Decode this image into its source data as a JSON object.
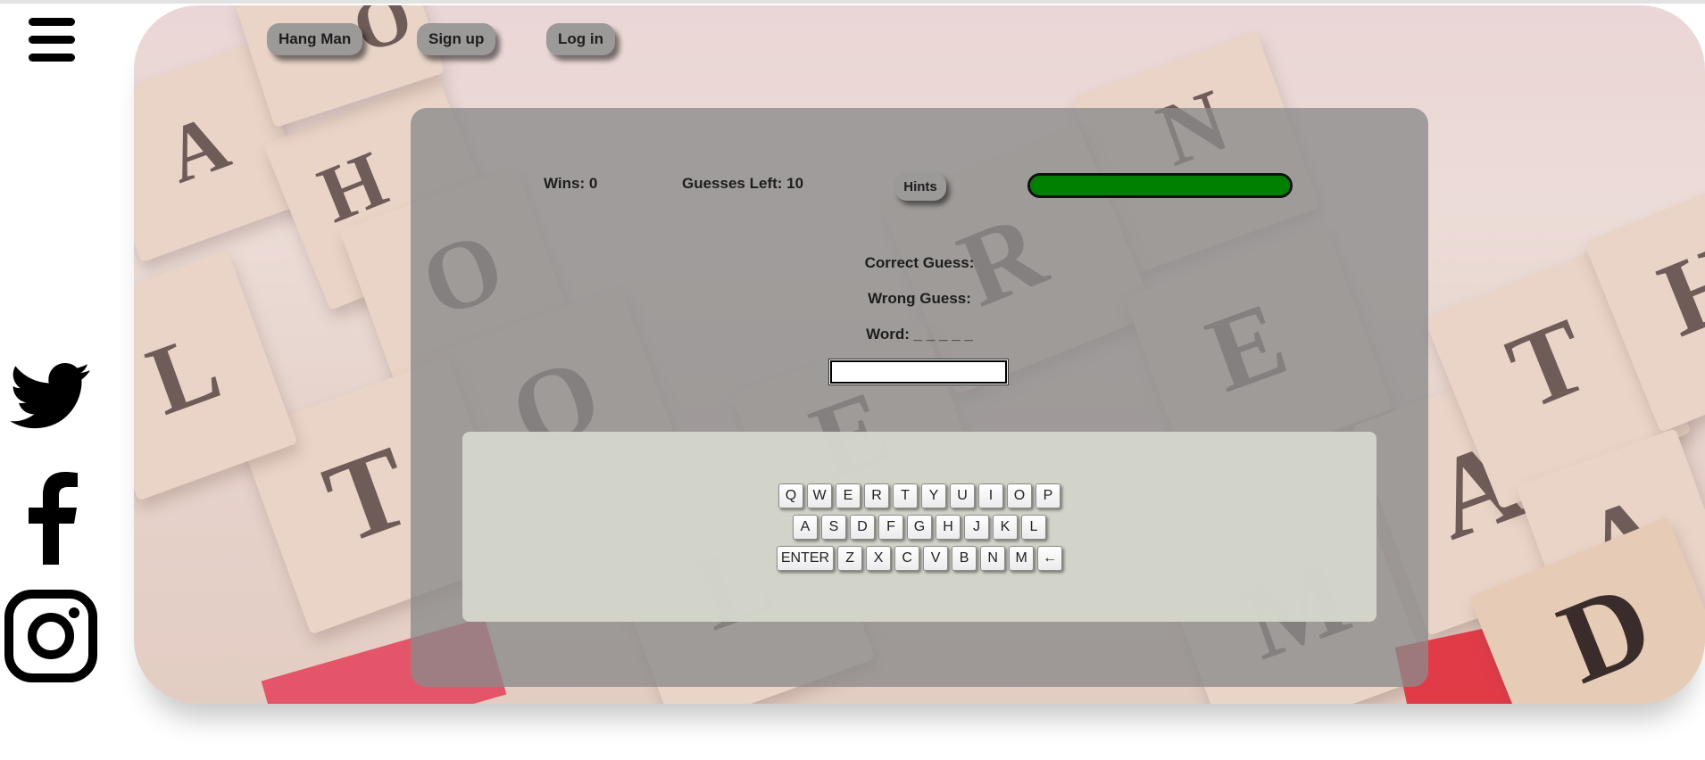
{
  "nav": {
    "buttons": [
      "Hang Man",
      "Sign up",
      "Log in"
    ]
  },
  "sidebar": {
    "menu_icon": "hamburger-menu-icon",
    "social": [
      "twitter-icon",
      "facebook-icon",
      "instagram-icon"
    ]
  },
  "background_tiles": [
    "A",
    "H",
    "O",
    "N",
    "O",
    "R",
    "E",
    "O",
    "T",
    "A",
    "E",
    "L",
    "T",
    "H",
    "A",
    "M",
    "D",
    "L"
  ],
  "game": {
    "wins_label": "Wins: 0",
    "guesses_left_label": "Guesses Left: 10",
    "hints_label": "Hints",
    "progress": 1.0,
    "correct_guess_label": "Correct Guess:",
    "wrong_guess_label": "Wrong Guess:",
    "word_label": "Word: _ _ _ _ _",
    "input_value": ""
  },
  "keyboard": {
    "row1": [
      "Q",
      "W",
      "E",
      "R",
      "T",
      "Y",
      "U",
      "I",
      "O",
      "P"
    ],
    "row2": [
      "A",
      "S",
      "D",
      "F",
      "G",
      "H",
      "J",
      "K",
      "L"
    ],
    "row3": [
      "ENTER",
      "Z",
      "X",
      "C",
      "V",
      "B",
      "N",
      "M",
      "←"
    ]
  },
  "colors": {
    "progress_fill": "#008000",
    "card": "#8b8a8a",
    "nav_button": "#9c9999",
    "keyboard_panel": "#d6d8cd"
  }
}
